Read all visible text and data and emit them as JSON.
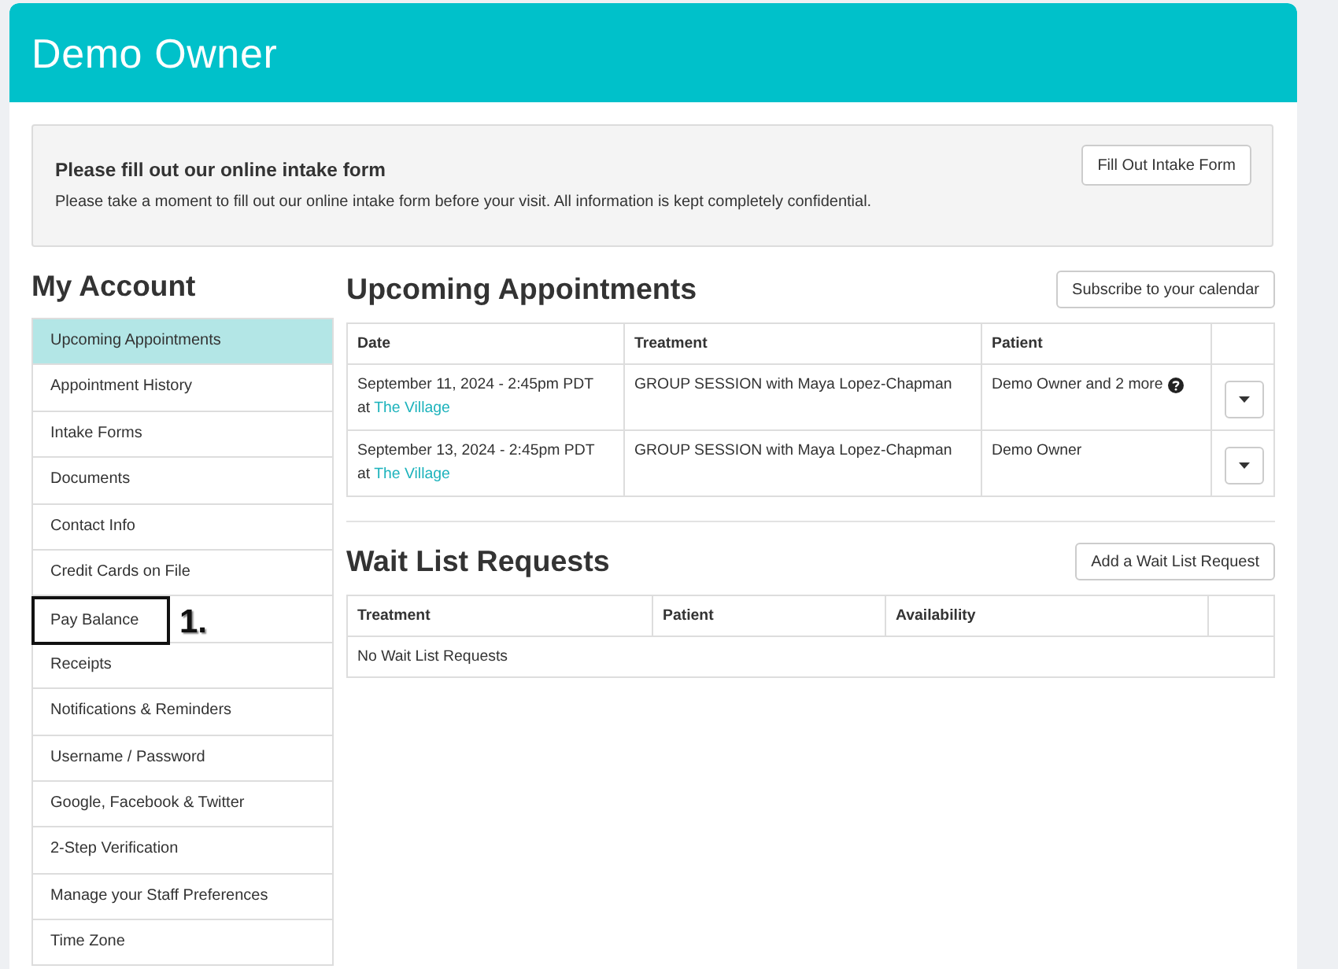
{
  "header": {
    "title": "Demo Owner"
  },
  "intake_notice": {
    "title": "Please fill out our online intake form",
    "text": "Please take a moment to fill out our online intake form before your visit. All information is kept completely confidential.",
    "button": "Fill Out Intake Form"
  },
  "sidebar": {
    "title": "My Account",
    "annotation_label": "1.",
    "items": [
      {
        "label": "Upcoming Appointments",
        "selected": true,
        "annotated": false
      },
      {
        "label": "Appointment History",
        "selected": false,
        "annotated": false
      },
      {
        "label": "Intake Forms",
        "selected": false,
        "annotated": false
      },
      {
        "label": "Documents",
        "selected": false,
        "annotated": false
      },
      {
        "label": "Contact Info",
        "selected": false,
        "annotated": false
      },
      {
        "label": "Credit Cards on File",
        "selected": false,
        "annotated": false
      },
      {
        "label": "Pay Balance",
        "selected": false,
        "annotated": true
      },
      {
        "label": "Receipts",
        "selected": false,
        "annotated": false
      },
      {
        "label": "Notifications & Reminders",
        "selected": false,
        "annotated": false
      },
      {
        "label": "Username / Password",
        "selected": false,
        "annotated": false
      },
      {
        "label": "Google, Facebook & Twitter",
        "selected": false,
        "annotated": false
      },
      {
        "label": "2-Step Verification",
        "selected": false,
        "annotated": false
      },
      {
        "label": "Manage your Staff Preferences",
        "selected": false,
        "annotated": false
      },
      {
        "label": "Time Zone",
        "selected": false,
        "annotated": false
      }
    ]
  },
  "sections": [
    {
      "kind": "appointments",
      "title": "Upcoming Appointments",
      "button": "Subscribe to your calendar",
      "columns": [
        "Date",
        "Treatment",
        "Patient"
      ],
      "rows": [
        {
          "date": "September 11, 2024 - 2:45pm PDT",
          "location_prefix": "at",
          "location": "The Village",
          "treatment": "GROUP SESSION with Maya Lopez-Chapman",
          "patient": "Demo Owner and 2 more",
          "patient_info": true
        },
        {
          "date": "September 13, 2024 - 2:45pm PDT",
          "location_prefix": "at",
          "location": "The Village",
          "treatment": "GROUP SESSION with Maya Lopez-Chapman",
          "patient": "Demo Owner",
          "patient_info": false
        }
      ]
    },
    {
      "kind": "wait_list",
      "title": "Wait List Requests",
      "button": "Add a Wait List Request",
      "columns": [
        "Treatment",
        "Patient",
        "Availability"
      ],
      "empty_message": "No Wait List Requests"
    }
  ]
}
